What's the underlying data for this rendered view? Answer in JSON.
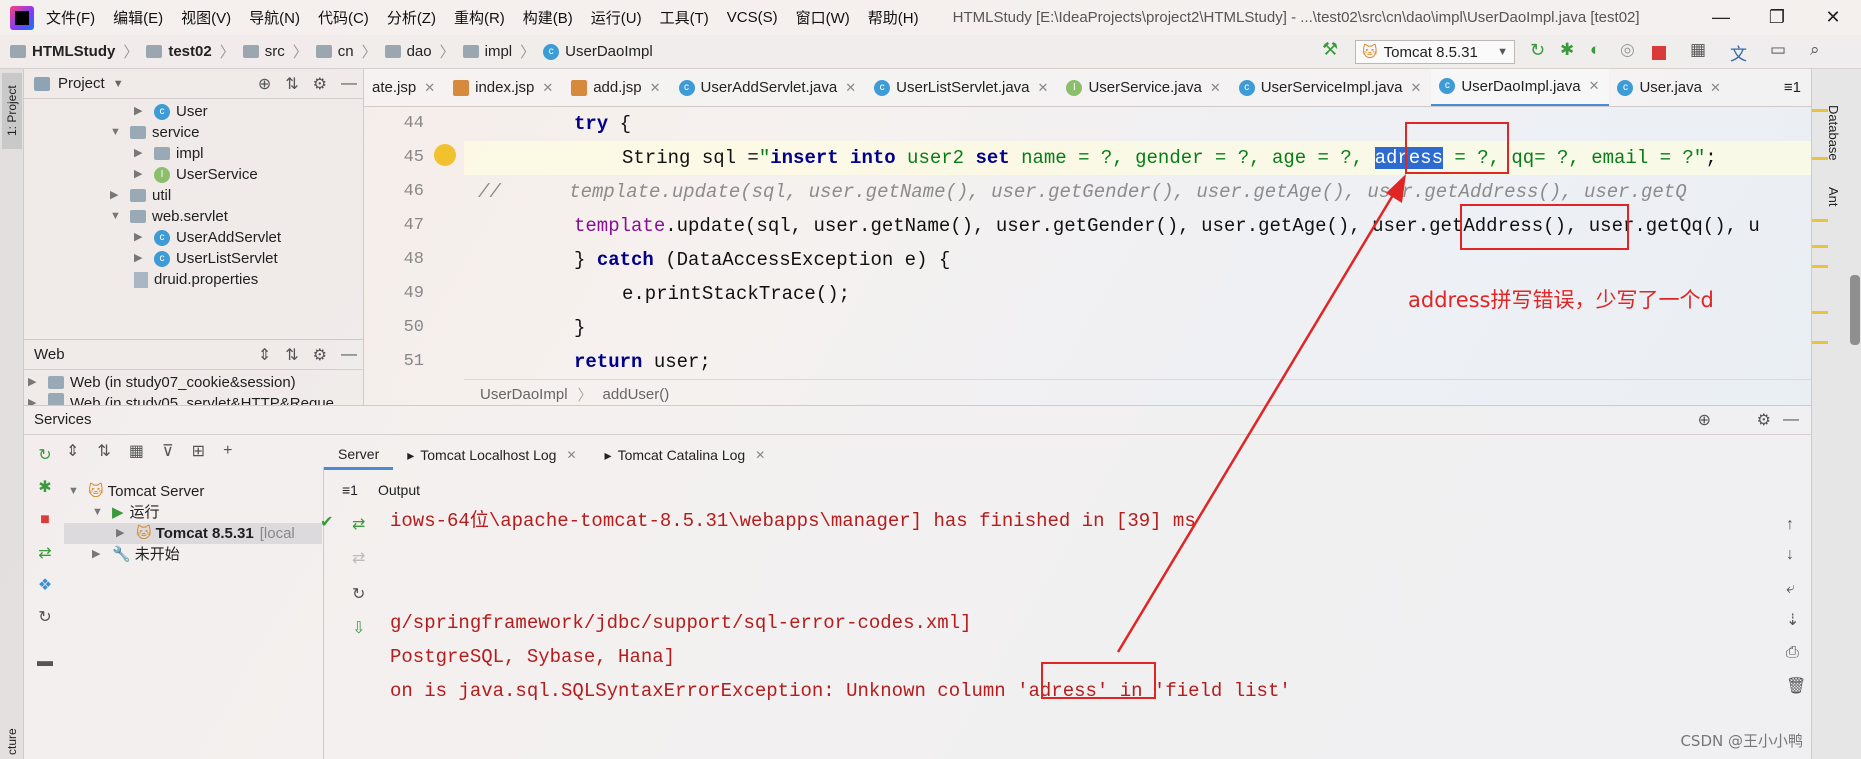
{
  "app": {
    "menus": [
      "文件(F)",
      "编辑(E)",
      "视图(V)",
      "导航(N)",
      "代码(C)",
      "分析(Z)",
      "重构(R)",
      "构建(B)",
      "运行(U)",
      "工具(T)",
      "VCS(S)",
      "窗口(W)",
      "帮助(H)"
    ],
    "window_title": "HTMLStudy [E:\\IdeaProjects\\project2\\HTMLStudy] - ...\\test02\\src\\cn\\dao\\impl\\UserDaoImpl.java [test02]"
  },
  "breadcrumb": [
    "HTMLStudy",
    "test02",
    "src",
    "cn",
    "dao",
    "impl",
    "UserDaoImpl"
  ],
  "run_config": "Tomcat 8.5.31",
  "project_panel": {
    "title": "Project",
    "tree": [
      {
        "label": "User",
        "kind": "class"
      },
      {
        "label": "service",
        "kind": "folder"
      },
      {
        "label": "impl",
        "kind": "folder"
      },
      {
        "label": "UserService",
        "kind": "interface"
      },
      {
        "label": "util",
        "kind": "folder"
      },
      {
        "label": "web.servlet",
        "kind": "folder"
      },
      {
        "label": "UserAddServlet",
        "kind": "class"
      },
      {
        "label": "UserListServlet",
        "kind": "class"
      },
      {
        "label": "druid.properties",
        "kind": "file"
      }
    ]
  },
  "web_panel": {
    "title": "Web",
    "items": [
      "Web (in study07_cookie&session)",
      "Web (in study05_servlet&HTTP&Reque"
    ]
  },
  "left_strip": {
    "project": "1: Project",
    "structure": "cture"
  },
  "right_strip": {
    "database": "Database",
    "ant": "Ant"
  },
  "editor": {
    "tabs": [
      "ate.jsp",
      "index.jsp",
      "add.jsp",
      "UserAddServlet.java",
      "UserListServlet.java",
      "UserService.java",
      "UserServiceImpl.java",
      "UserDaoImpl.java",
      "User.java"
    ],
    "active_tab": "UserDaoImpl.java",
    "tab_overflow": "≡1",
    "line_numbers": [
      "44",
      "45",
      "46",
      "47",
      "48",
      "49",
      "50",
      "51"
    ],
    "lines": {
      "l44_kw": "try",
      "l44_rest": " {",
      "l45_a": "String sql =",
      "l45_b": "\"",
      "l45_c": "insert into",
      "l45_d": " user2 ",
      "l45_e": "set",
      "l45_f": " name = ?, gender = ?, age = ?, ",
      "l45_sel": "adress",
      "l45_g": " = ?, qq= ?, email = ?\"",
      "l45_h": ";",
      "l46": "//      template.update(sql, user.getName(), user.getGender(), user.getAge(), user.getAddress(), user.getQ",
      "l47_fld": "template",
      "l47_rest": ".update(sql, user.getName(), user.getGender(), user.getAge(), user.getAddress(), user.getQq(), u",
      "l48_a": "} ",
      "l48_kw": "catch",
      "l48_rest": " (DataAccessException e) {",
      "l49": "e.printStackTrace();",
      "l50": "}",
      "l51_kw": "return",
      "l51_rest": " user;"
    },
    "breadcrumb": [
      "UserDaoImpl",
      "addUser()"
    ]
  },
  "services": {
    "title": "Services",
    "tree": [
      {
        "label": "Tomcat Server"
      },
      {
        "label": "运行"
      },
      {
        "label": "Tomcat 8.5.31",
        "suffix": "[local"
      },
      {
        "label": "未开始"
      }
    ],
    "tabs": [
      "Server",
      "Tomcat Localhost Log",
      "Tomcat Catalina Log"
    ],
    "output_label": "Output",
    "output_prefix": "≡1",
    "output_lines": [
      "iows-64位\\apache-tomcat-8.5.31\\webapps\\manager] has finished in [39] ms",
      "",
      "",
      "g/springframework/jdbc/support/sql-error-codes.xml]",
      "PostgreSQL, Sybase, Hana]",
      "on is java.sql.SQLSyntaxErrorException: Unknown column 'adress' in 'field list'"
    ]
  },
  "annotation": {
    "text": "address拼写错误，少写了一个d",
    "color": "#e12424"
  },
  "watermark": "CSDN @王小小鸭"
}
